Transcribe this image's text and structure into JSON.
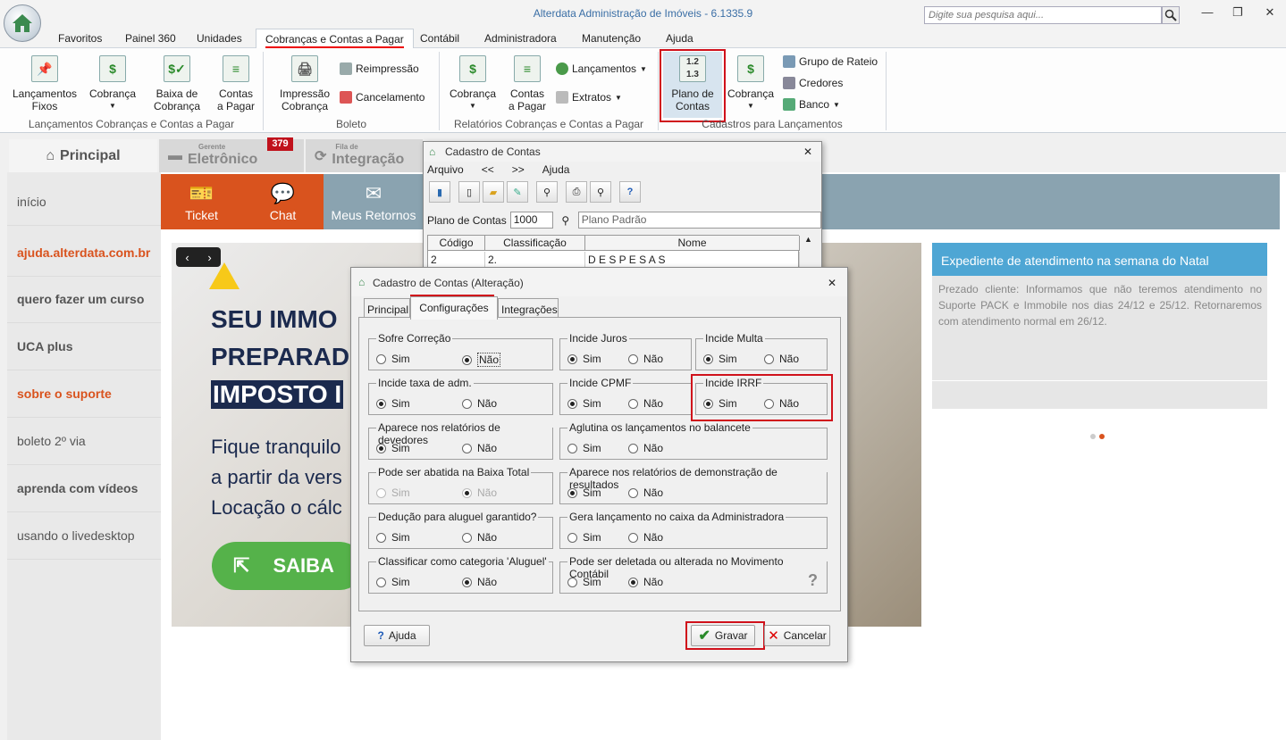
{
  "app": {
    "title": "Alterdata Administração de Imóveis - 6.1335.9",
    "search_placeholder": "Digite sua pesquisa aqui..."
  },
  "menu": {
    "tabs": [
      "Favoritos",
      "Painel 360",
      "Unidades",
      "Cobranças e Contas a Pagar",
      "Contábil",
      "Administradora",
      "Manutenção",
      "Ajuda"
    ],
    "active": "Cobranças e Contas a Pagar"
  },
  "ribbon": {
    "lanc_fixos": "Lançamentos\nFixos",
    "cobranca": "Cobrança",
    "baixa": "Baixa de\nCobrança",
    "contas_pagar": "Contas\na Pagar",
    "group1": "Lançamentos Cobranças e Contas a Pagar",
    "impressao": "Impressão\nCobrança",
    "reimpressao": "Reimpressão",
    "cancelamento": "Cancelamento",
    "group2": "Boleto",
    "rel_cobranca": "Cobrança",
    "rel_contas": "Contas\na Pagar",
    "lancamentos": "Lançamentos",
    "extratos": "Extratos",
    "group3": "Relatórios Cobranças e Contas a Pagar",
    "plano": "Plano de\nContas",
    "cad_cobranca": "Cobrança",
    "grupo_rateio": "Grupo de Rateio",
    "credores": "Credores",
    "banco": "Banco",
    "group4": "Cadastros para Lançamentos"
  },
  "doctabs": {
    "principal": "Principal",
    "gerente_small": "Gerente",
    "gerente": "Eletrônico",
    "fila_small": "Fila de",
    "fila": "Integração",
    "badge": "379"
  },
  "sidebar": [
    "início",
    "ajuda.alterdata.com.br",
    "quero fazer um curso",
    "UCA plus",
    "sobre o suporte",
    "boleto 2º via",
    "aprenda com vídeos",
    "usando o livedesktop"
  ],
  "strip": {
    "ticket": "Ticket",
    "chat": "Chat",
    "retornos": "Meus Retornos"
  },
  "banner": {
    "l1": "SEU IMMO",
    "l2": "PREPARAD",
    "l3": "IMPOSTO I",
    "l4": "Fique tranquilo",
    "l5": "a partir da vers",
    "l6": "Locação o cálc",
    "cta": "SAIBA"
  },
  "news": {
    "title": "Expediente de atendimento na semana do Natal",
    "body": "Prezado cliente: Informamos que não teremos atendimento no Suporte PACK e Immobile nos dias 24/12 e 25/12. Retornaremos com atendimento normal em 26/12."
  },
  "dlg1": {
    "title": "Cadastro de Contas",
    "menu": [
      "Arquivo",
      "<<",
      ">>",
      "Ajuda"
    ],
    "plano_label": "Plano de Contas",
    "plano_code": "1000",
    "plano_name": "Plano Padrão",
    "columns": [
      "Código",
      "Classificação",
      "Nome"
    ],
    "row": [
      "2",
      "2.",
      "D E S P E S A S"
    ]
  },
  "dlg2": {
    "title": "Cadastro de Contas (Alteração)",
    "tabs": [
      "Principal",
      "Configurações",
      "Integrações"
    ],
    "sim": "Sim",
    "nao": "Não",
    "groups": [
      {
        "label": "Sofre Correção",
        "value": "Não"
      },
      {
        "label": "Incide Juros",
        "value": "Sim"
      },
      {
        "label": "Incide Multa",
        "value": "Sim"
      },
      {
        "label": "Incide taxa de adm.",
        "value": "Sim"
      },
      {
        "label": "Incide CPMF",
        "value": "Sim"
      },
      {
        "label": "Incide IRRF",
        "value": "Sim"
      },
      {
        "label": "Aparece nos relatórios de devedores",
        "value": "Sim"
      },
      {
        "label": "Aglutina os lançamentos no balancete",
        "value": ""
      },
      {
        "label": "Pode ser abatida na Baixa Total",
        "value": "Não",
        "disabled": true
      },
      {
        "label": "Aparece nos relatórios de demonstração de resultados",
        "value": "Sim"
      },
      {
        "label": "Dedução para aluguel garantido?",
        "value": ""
      },
      {
        "label": "Gera lançamento no caixa da Administradora",
        "value": ""
      },
      {
        "label": "Classificar como categoria 'Aluguel'",
        "value": "Não"
      },
      {
        "label": "Pode ser deletada ou alterada no Movimento Contábil",
        "value": "Não"
      }
    ],
    "help": "Ajuda",
    "save": "Gravar",
    "cancel": "Cancelar"
  }
}
